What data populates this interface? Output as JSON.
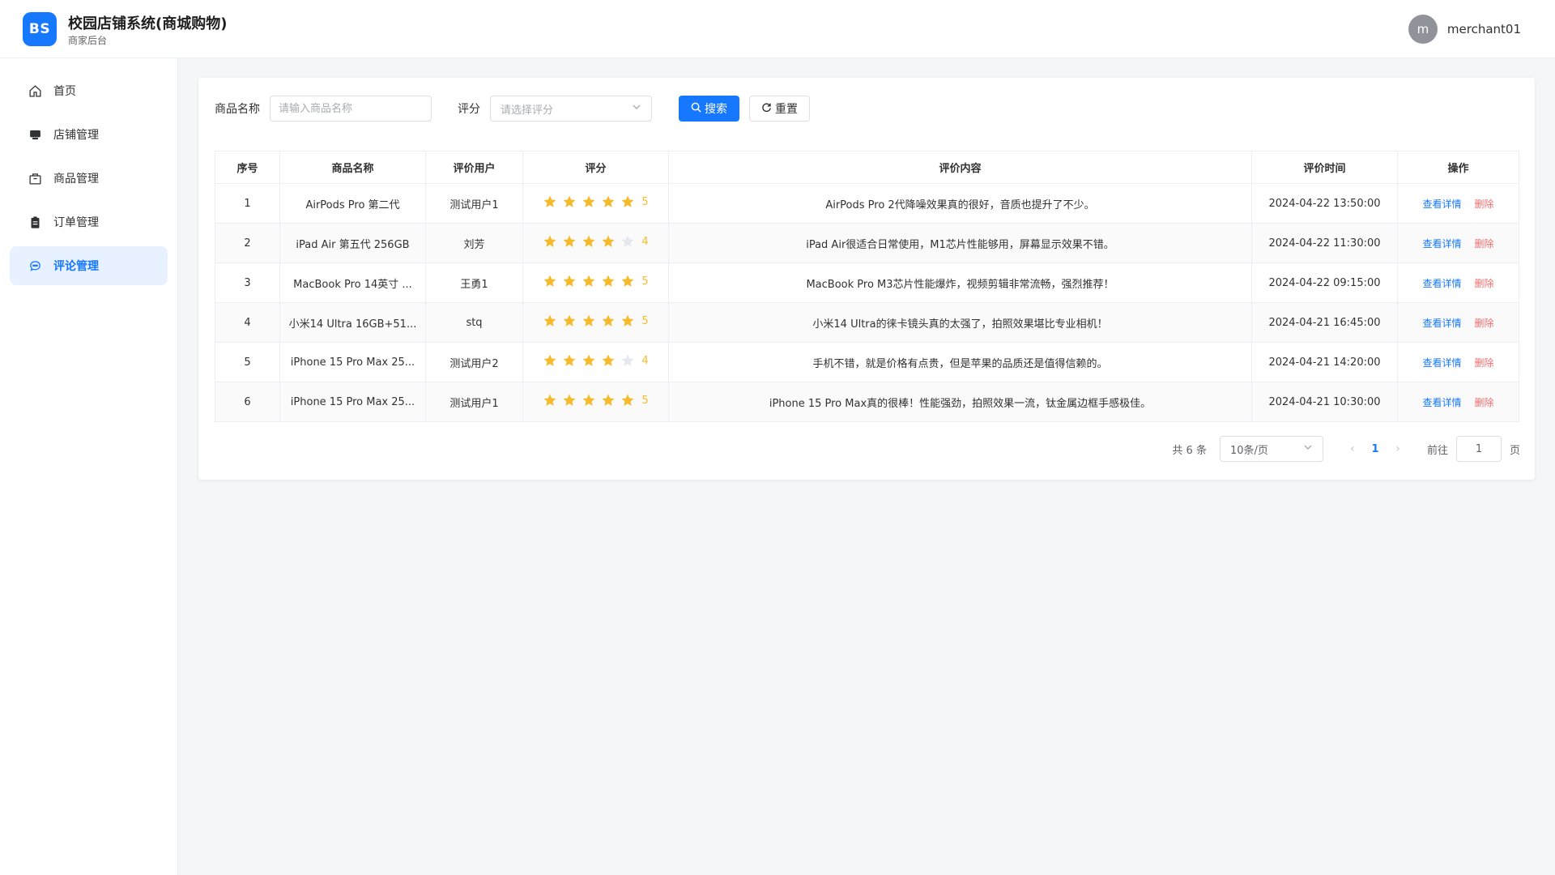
{
  "header": {
    "logo_text": "BS",
    "title": "校园店铺系统(商城购物)",
    "subtitle": "商家后台",
    "user_initial": "m",
    "username": "merchant01"
  },
  "sidebar": {
    "items": [
      {
        "label": "首页",
        "icon": "home-icon"
      },
      {
        "label": "店铺管理",
        "icon": "shop-icon"
      },
      {
        "label": "商品管理",
        "icon": "box-icon"
      },
      {
        "label": "订单管理",
        "icon": "clipboard-icon"
      },
      {
        "label": "评论管理",
        "icon": "chat-icon",
        "active": true
      }
    ]
  },
  "filters": {
    "product_label": "商品名称",
    "product_placeholder": "请输入商品名称",
    "rating_label": "评分",
    "rating_placeholder": "请选择评分",
    "search_label": "搜索",
    "reset_label": "重置"
  },
  "table": {
    "columns": [
      "序号",
      "商品名称",
      "评价用户",
      "评分",
      "评价内容",
      "评价时间",
      "操作"
    ],
    "rows": [
      {
        "no": "1",
        "product": "AirPods Pro 第二代",
        "user": "测试用户1",
        "rating": 5,
        "content": "AirPods Pro 2代降噪效果真的很好，音质也提升了不少。",
        "time": "2024-04-22 13:50:00"
      },
      {
        "no": "2",
        "product": "iPad Air 第五代 256GB",
        "user": "刘芳",
        "rating": 4,
        "content": "iPad Air很适合日常使用，M1芯片性能够用，屏幕显示效果不错。",
        "time": "2024-04-22 11:30:00"
      },
      {
        "no": "3",
        "product": "MacBook Pro 14英寸 ...",
        "user": "王勇1",
        "rating": 5,
        "content": "MacBook Pro M3芯片性能爆炸，视频剪辑非常流畅，强烈推荐！",
        "time": "2024-04-22 09:15:00"
      },
      {
        "no": "4",
        "product": "小米14 Ultra 16GB+51...",
        "user": "stq",
        "rating": 5,
        "content": "小米14 Ultra的徕卡镜头真的太强了，拍照效果堪比专业相机！",
        "time": "2024-04-21 16:45:00"
      },
      {
        "no": "5",
        "product": "iPhone 15 Pro Max 25...",
        "user": "测试用户2",
        "rating": 4,
        "content": "手机不错，就是价格有点贵，但是苹果的品质还是值得信赖的。",
        "time": "2024-04-21 14:20:00"
      },
      {
        "no": "6",
        "product": "iPhone 15 Pro Max 25...",
        "user": "测试用户1",
        "rating": 5,
        "content": "iPhone 15 Pro Max真的很棒！性能强劲，拍照效果一流，钛金属边框手感极佳。",
        "time": "2024-04-21 10:30:00"
      }
    ],
    "view_label": "查看详情",
    "delete_label": "删除",
    "max_stars": 5
  },
  "pagination": {
    "total_text": "共 6 条",
    "page_size": "10条/页",
    "current_page": "1",
    "goto_label": "前往",
    "goto_value": "1",
    "page_suffix": "页"
  },
  "colors": {
    "primary": "#1677ff",
    "star": "#f7ba2a",
    "star_empty": "#e4e7ed",
    "danger": "#f56c6c"
  }
}
